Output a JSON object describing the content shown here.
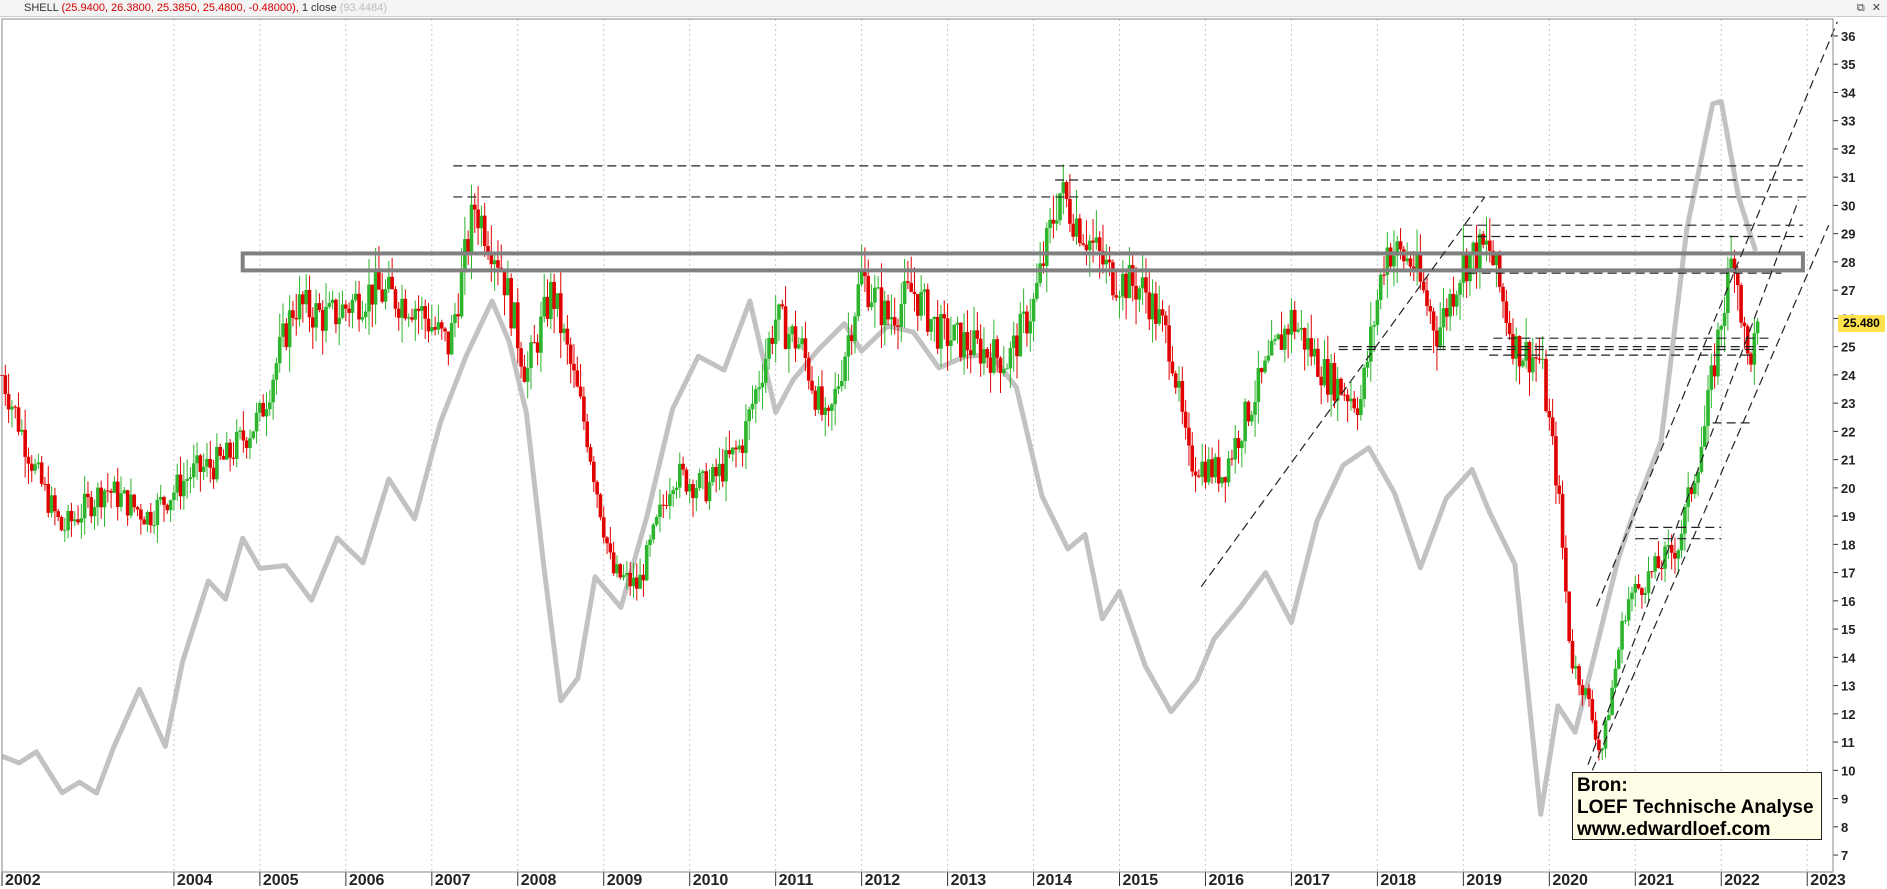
{
  "header": {
    "symbol": "SHELL",
    "ohlc": "(25.9400, 26.3800, 25.3850, 25.4800, -0.48000),",
    "indicator": " 1 close",
    "indicator_value": " (93.4484)"
  },
  "window_icons": [
    "pin-icon",
    "close-icon"
  ],
  "current_price": "25.480",
  "source_box": {
    "line1": "Bron:",
    "line2": "LOEF Technische Analyse",
    "line3": "www.edwardloef.com"
  },
  "colors": {
    "up": "#2db52d",
    "down": "#e00000",
    "overlay": "#c2c2c2",
    "resistance_box": "#808080",
    "price_tag": "#ffe24d"
  },
  "chart_data": {
    "type": "candlestick",
    "x_tick_labels": [
      "2002",
      "2004",
      "2005",
      "2006",
      "2007",
      "2008",
      "2009",
      "2010",
      "2011",
      "2012",
      "2013",
      "2014",
      "2015",
      "2016",
      "2017",
      "2018",
      "2019",
      "2020",
      "2021",
      "2022",
      "2023"
    ],
    "y_tick_labels": [
      "7",
      "8",
      "9",
      "10",
      "11",
      "12",
      "13",
      "14",
      "15",
      "16",
      "17",
      "18",
      "19",
      "20",
      "21",
      "22",
      "23",
      "24",
      "25",
      "26",
      "27",
      "28",
      "29",
      "30",
      "31",
      "32",
      "33",
      "34",
      "35",
      "36"
    ],
    "ylim": [
      6.4,
      36.6
    ],
    "xlim": [
      2002.0,
      2023.3
    ],
    "y_axis_side": "right",
    "grid": "vertical dotted",
    "price_anchors": {
      "x": [
        2002.0,
        2002.4,
        2002.7,
        2003.2,
        2003.7,
        2004.2,
        2004.6,
        2005.0,
        2005.4,
        2005.8,
        2006.3,
        2006.8,
        2007.2,
        2007.5,
        2007.8,
        2008.1,
        2008.4,
        2008.8,
        2009.1,
        2009.4,
        2009.8,
        2010.2,
        2010.6,
        2011.0,
        2011.3,
        2011.6,
        2012.0,
        2012.3,
        2012.6,
        2012.9,
        2013.3,
        2013.7,
        2014.0,
        2014.3,
        2014.6,
        2014.9,
        2015.3,
        2015.6,
        2015.8,
        2016.2,
        2016.6,
        2017.0,
        2017.4,
        2017.8,
        2018.1,
        2018.4,
        2018.7,
        2019.0,
        2019.3,
        2019.6,
        2019.9,
        2020.1,
        2020.25,
        2020.45,
        2020.6,
        2020.9,
        2021.2,
        2021.5,
        2021.8,
        2022.0,
        2022.15,
        2022.3,
        2022.45
      ],
      "y": [
        24.0,
        20.5,
        18.5,
        20.0,
        19.0,
        20.5,
        21.0,
        22.5,
        26.5,
        26.0,
        27.0,
        26.5,
        25.0,
        30.0,
        28.0,
        24.0,
        27.0,
        22.0,
        17.0,
        16.5,
        20.5,
        20.0,
        21.5,
        26.0,
        25.0,
        22.0,
        27.5,
        26.0,
        27.0,
        25.5,
        25.0,
        24.5,
        26.5,
        30.5,
        29.0,
        27.5,
        27.0,
        25.0,
        21.0,
        20.5,
        23.5,
        26.0,
        24.0,
        23.0,
        28.5,
        28.0,
        25.5,
        28.0,
        28.5,
        25.0,
        24.5,
        20.0,
        14.0,
        12.5,
        10.5,
        16.0,
        17.0,
        18.0,
        22.0,
        26.0,
        28.5,
        24.5,
        25.5
      ]
    },
    "overlay_series": {
      "name": "1 close",
      "x": [
        2002.0,
        2002.2,
        2002.4,
        2002.7,
        2002.9,
        2003.1,
        2003.3,
        2003.6,
        2003.9,
        2004.1,
        2004.4,
        2004.6,
        2004.8,
        2005.0,
        2005.3,
        2005.6,
        2005.9,
        2006.2,
        2006.5,
        2006.8,
        2007.1,
        2007.4,
        2007.7,
        2007.9,
        2008.1,
        2008.3,
        2008.5,
        2008.7,
        2008.9,
        2009.2,
        2009.5,
        2009.8,
        2010.1,
        2010.4,
        2010.7,
        2011.0,
        2011.2,
        2011.5,
        2011.8,
        2012.0,
        2012.3,
        2012.6,
        2012.9,
        2013.2,
        2013.5,
        2013.8,
        2014.1,
        2014.4,
        2014.6,
        2014.8,
        2015.0,
        2015.3,
        2015.6,
        2015.9,
        2016.1,
        2016.4,
        2016.7,
        2017.0,
        2017.3,
        2017.6,
        2017.9,
        2018.2,
        2018.5,
        2018.8,
        2019.1,
        2019.3,
        2019.6,
        2019.9,
        2020.1,
        2020.3,
        2020.5,
        2020.8,
        2021.0,
        2021.3,
        2021.6,
        2021.9,
        2022.0,
        2022.2,
        2022.4
      ],
      "y": [
        10.5,
        10.0,
        11.0,
        9.0,
        9.5,
        9.5,
        10.5,
        13.0,
        11.0,
        13.5,
        17.0,
        16.0,
        18.0,
        17.5,
        17.0,
        16.0,
        18.5,
        17.0,
        20.5,
        19.0,
        22.0,
        25.0,
        26.5,
        25.0,
        23.0,
        17.0,
        12.5,
        13.5,
        16.5,
        16.0,
        19.0,
        22.5,
        25.0,
        24.0,
        26.5,
        23.0,
        23.5,
        25.0,
        26.0,
        24.5,
        26.0,
        25.5,
        24.0,
        25.0,
        24.5,
        23.5,
        20.0,
        17.5,
        18.5,
        15.5,
        16.0,
        14.0,
        12.0,
        13.0,
        15.0,
        15.5,
        17.0,
        15.5,
        18.5,
        21.0,
        21.5,
        19.5,
        17.5,
        19.5,
        20.5,
        19.5,
        17.0,
        8.5,
        12.5,
        11.0,
        14.0,
        17.5,
        19.0,
        22.0,
        29.0,
        33.5,
        34.0,
        30.0,
        28.5
      ]
    },
    "drawn_objects": {
      "resistance_zone": [
        27.7,
        28.3
      ],
      "horizontal_levels": [
        31.4,
        30.9,
        30.3,
        29.3,
        28.9,
        27.6,
        25.3,
        25.0,
        24.9,
        24.7,
        22.3,
        18.6,
        18.2
      ],
      "trendlines": [
        {
          "x": [
            2015.95,
            2019.25
          ],
          "y": [
            16.5,
            30.3
          ]
        },
        {
          "x": [
            2020.5,
            2023.25
          ],
          "y": [
            10.0,
            29.3
          ]
        },
        {
          "x": [
            2020.55,
            2023.35
          ],
          "y": [
            15.8,
            36.5
          ]
        },
        {
          "x": [
            2020.45,
            2022.9
          ],
          "y": [
            10.2,
            30.2
          ]
        }
      ]
    }
  }
}
